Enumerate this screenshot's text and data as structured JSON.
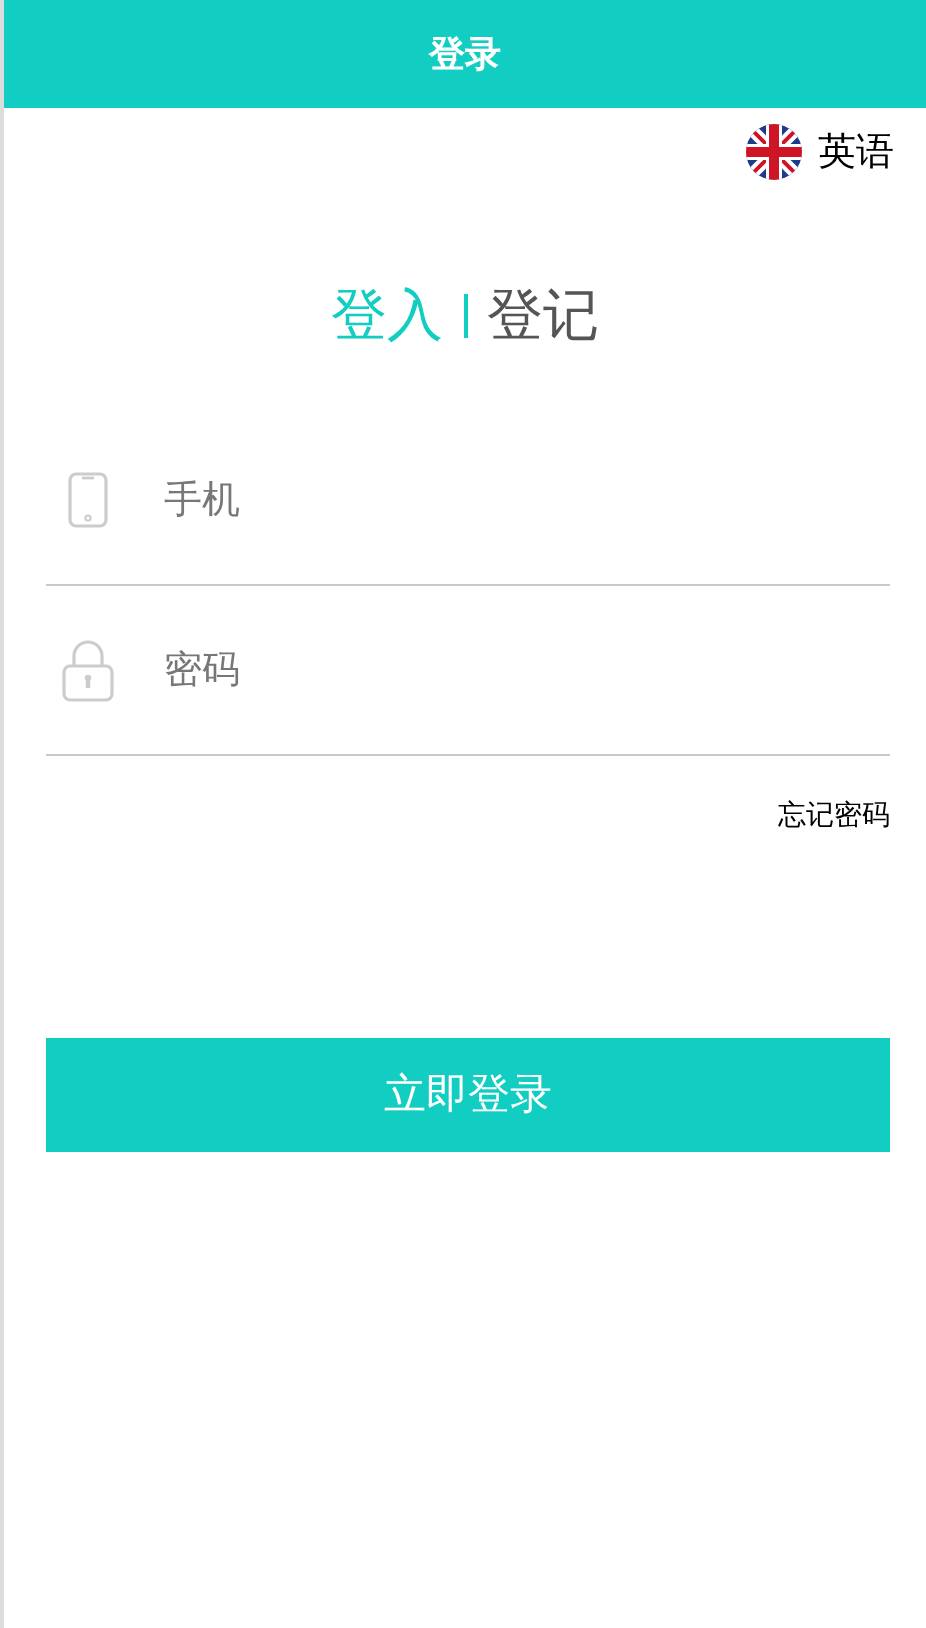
{
  "header": {
    "title": "登录"
  },
  "language": {
    "label": "英语"
  },
  "tabs": [
    {
      "label": "登入",
      "selected": true
    },
    {
      "label": "登记",
      "selected": false
    }
  ],
  "fields": [
    {
      "kind": "phone",
      "placeholder": "手机"
    },
    {
      "kind": "password",
      "placeholder": "密码"
    }
  ],
  "forgot_link": "忘记密码",
  "submit_button": "立即登录"
}
